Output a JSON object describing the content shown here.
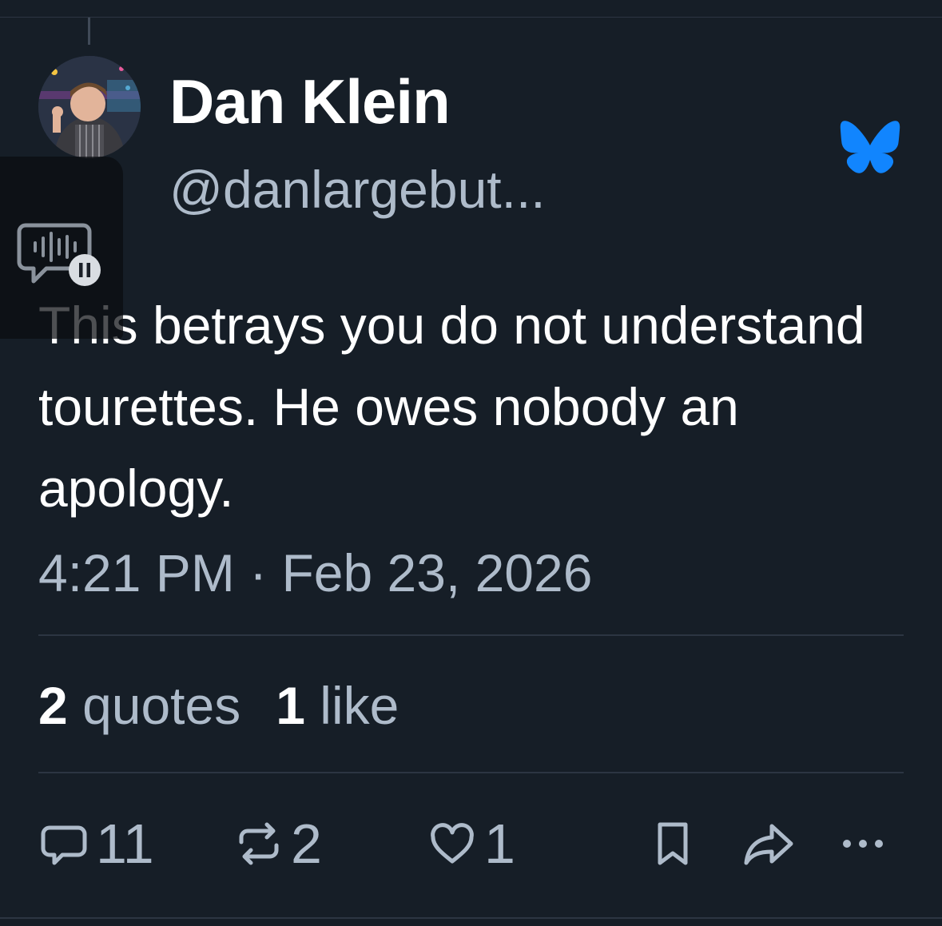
{
  "author": {
    "display_name": "Dan Klein",
    "handle": "@danlargebut..."
  },
  "platform": {
    "logo_icon": "butterfly-icon",
    "logo_color": "#1185fe"
  },
  "voice_overlay": {
    "icon": "voice-wave-pause-icon"
  },
  "post": {
    "text": "This betrays you do not understand tourettes. He owes nobody an apology.",
    "timestamp": "4:21 PM · Feb 23, 2026"
  },
  "stats": {
    "quotes_count": "2",
    "quotes_label": "quotes",
    "likes_count": "1",
    "likes_label": "like"
  },
  "actions": {
    "reply_icon": "reply-bubble-icon",
    "reply_count": "11",
    "repost_icon": "repost-icon",
    "repost_count": "2",
    "like_icon": "heart-icon",
    "like_count": "1",
    "bookmark_icon": "bookmark-icon",
    "share_icon": "share-arrow-icon",
    "more_icon": "more-dots-icon"
  },
  "colors": {
    "background": "#161e27",
    "text_primary": "#ffffff",
    "text_secondary": "#aebbca",
    "divider": "#2c3542"
  }
}
